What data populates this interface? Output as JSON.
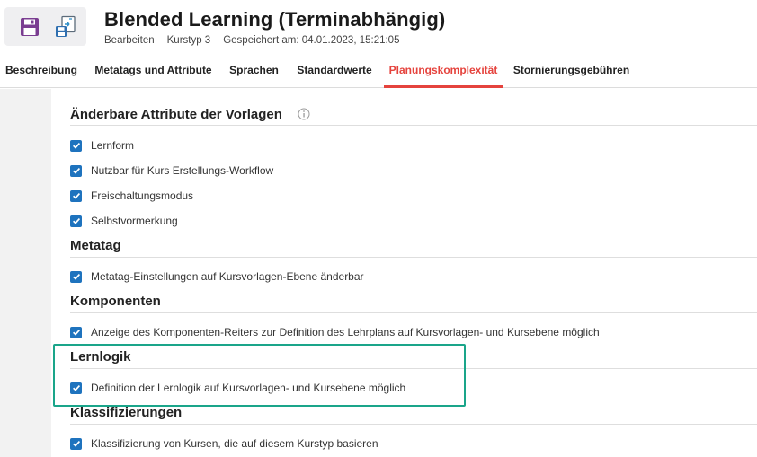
{
  "header": {
    "title": "Blended Learning (Terminabhängig)",
    "meta": {
      "mode": "Bearbeiten",
      "course_type": "Kurstyp 3",
      "saved": "Gespeichert am: 04.01.2023, 15:21:05"
    },
    "toolbar": {
      "save_icon": "save-icon",
      "export_icon": "export-icon"
    }
  },
  "tabs": [
    {
      "label": "Beschreibung"
    },
    {
      "label": "Metatags und Attribute"
    },
    {
      "label": "Sprachen"
    },
    {
      "label": "Standardwerte"
    },
    {
      "label": "Planungskomplexität",
      "active": true
    },
    {
      "label": "Stornierungsgebühren"
    }
  ],
  "sections": [
    {
      "title": "Änderbare Attribute der Vorlagen",
      "info_icon": true,
      "items": [
        {
          "label": "Lernform",
          "checked": true
        },
        {
          "label": "Nutzbar für Kurs Erstellungs-Workflow",
          "checked": true
        },
        {
          "label": "Freischaltungsmodus",
          "checked": true
        },
        {
          "label": "Selbstvormerkung",
          "checked": true
        }
      ]
    },
    {
      "title": "Metatag",
      "items": [
        {
          "label": "Metatag-Einstellungen auf Kursvorlagen-Ebene änderbar",
          "checked": true
        }
      ]
    },
    {
      "title": "Komponenten",
      "items": [
        {
          "label": "Anzeige des Komponenten-Reiters zur Definition des Lehrplans auf Kursvorlagen- und Kursebene möglich",
          "checked": true
        }
      ]
    },
    {
      "title": "Lernlogik",
      "items": [
        {
          "label": "Definition der Lernlogik auf Kursvorlagen- und Kursebene möglich",
          "checked": true
        }
      ]
    },
    {
      "title": "Klassifizierungen",
      "items": [
        {
          "label": "Klassifizierung von Kursen, die auf diesem Kurstyp basieren",
          "checked": true
        }
      ]
    }
  ],
  "colors": {
    "accent": "#e5433d",
    "checkbox": "#1e73be",
    "highlight": "#1aa58a"
  }
}
